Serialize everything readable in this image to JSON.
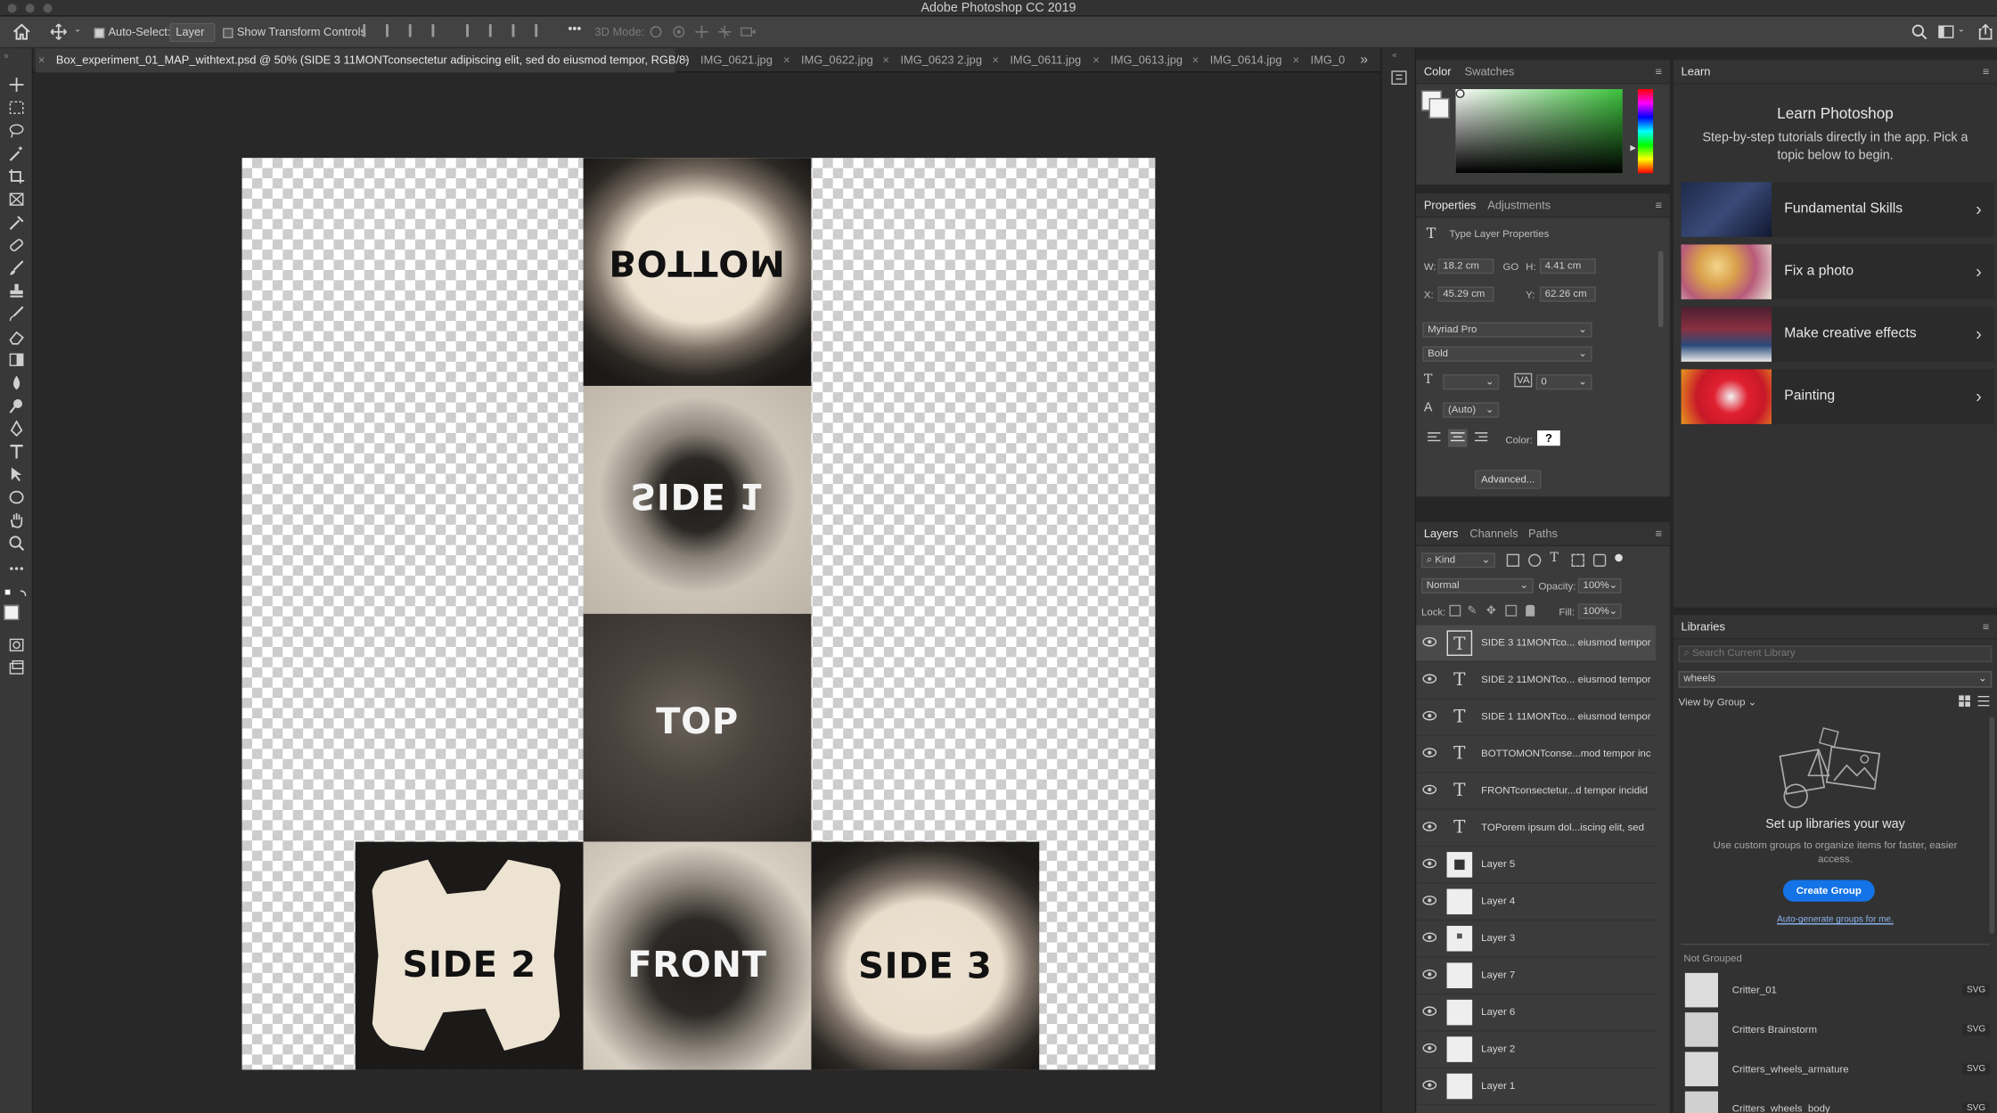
{
  "app_title": "Adobe Photoshop CC 2019",
  "options": {
    "auto_select_label": "Auto-Select:",
    "auto_select_value": "Layer",
    "show_transform_label": "Show Transform Controls",
    "mode_3d_label": "3D Mode:",
    "more": "•••"
  },
  "tabs": [
    {
      "label": "Box_experiment_01_MAP_withtext.psd @ 50% (SIDE 3 11MONTconsectetur adipiscing elit, sed do eiusmod tempor, RGB/8)",
      "active": true
    },
    {
      "label": "IMG_0621.jpg"
    },
    {
      "label": "IMG_0622.jpg"
    },
    {
      "label": "IMG_0623 2.jpg"
    },
    {
      "label": "IMG_0611.jpg"
    },
    {
      "label": "IMG_0613.jpg"
    },
    {
      "label": "IMG_0614.jpg"
    },
    {
      "label": "IMG_0"
    }
  ],
  "tabs_overflow": "»",
  "canvas": {
    "labels": {
      "bottom": "BOTTOM",
      "side1": "SIDE 1",
      "top": "TOP",
      "side2": "SIDE 2",
      "front": "FRONT",
      "side3": "SIDE 3"
    }
  },
  "color_panel": {
    "tabs": [
      "Color",
      "Swatches"
    ],
    "accent": "#3cc23c"
  },
  "properties": {
    "tabs": [
      "Properties",
      "Adjustments"
    ],
    "type_label": "Type Layer Properties",
    "w_label": "W:",
    "w_value": "18.2 cm",
    "go_label": "GO",
    "h_label": "H:",
    "h_value": "4.41 cm",
    "x_label": "X:",
    "x_value": "45.29 cm",
    "y_label": "Y:",
    "y_value": "62.26 cm",
    "font_family": "Myriad Pro",
    "font_style": "Bold",
    "tracking_value": "0",
    "leading_value": "(Auto)",
    "color_label": "Color:",
    "color_value": "?",
    "advanced_button": "Advanced..."
  },
  "layers_panel": {
    "tabs": [
      "Layers",
      "Channels",
      "Paths"
    ],
    "kind_filter": "Kind",
    "blend_mode": "Normal",
    "opacity_label": "Opacity:",
    "opacity_value": "100%",
    "lock_label": "Lock:",
    "fill_label": "Fill:",
    "fill_value": "100%",
    "layers": [
      {
        "name": "SIDE 3 11MONTco... eiusmod tempor",
        "type": "text",
        "selected": true
      },
      {
        "name": "SIDE 2 11MONTco... eiusmod tempor",
        "type": "text"
      },
      {
        "name": "SIDE 1 11MONTco... eiusmod tempor",
        "type": "text"
      },
      {
        "name": "BOTTOMONTconse...mod tempor inc",
        "type": "text"
      },
      {
        "name": "FRONTconsectetur...d tempor incidid",
        "type": "text"
      },
      {
        "name": "TOPorem ipsum dol...iscing elit, sed",
        "type": "text"
      },
      {
        "name": "Layer 5",
        "type": "image"
      },
      {
        "name": "Layer 4",
        "type": "image"
      },
      {
        "name": "Layer 3",
        "type": "image"
      },
      {
        "name": "Layer 7",
        "type": "image"
      },
      {
        "name": "Layer 6",
        "type": "image"
      },
      {
        "name": "Layer 2",
        "type": "image"
      },
      {
        "name": "Layer 1",
        "type": "image"
      }
    ]
  },
  "learn": {
    "tab": "Learn",
    "title": "Learn Photoshop",
    "subtitle": "Step-by-step tutorials directly in the app. Pick a topic below to begin.",
    "cards": [
      {
        "label": "Fundamental Skills"
      },
      {
        "label": "Fix a photo"
      },
      {
        "label": "Make creative effects"
      },
      {
        "label": "Painting"
      }
    ]
  },
  "libraries": {
    "tab": "Libraries",
    "search_placeholder": "Search Current Library",
    "library_name": "wheels",
    "view_by": "View by Group",
    "setup_title": "Set up libraries your way",
    "setup_text": "Use custom groups to organize items for faster, easier access.",
    "create_group": "Create Group",
    "auto_generate": "Auto-generate groups for me.",
    "not_grouped": "Not Grouped",
    "items": [
      {
        "name": "Critter_01",
        "badge": "SVG"
      },
      {
        "name": "Critters Brainstorm",
        "badge": "SVG"
      },
      {
        "name": "Critters_wheels_armature",
        "badge": "SVG"
      },
      {
        "name": "Critters_wheels_body",
        "badge": "SVG"
      }
    ],
    "accent": "#1473e6"
  }
}
